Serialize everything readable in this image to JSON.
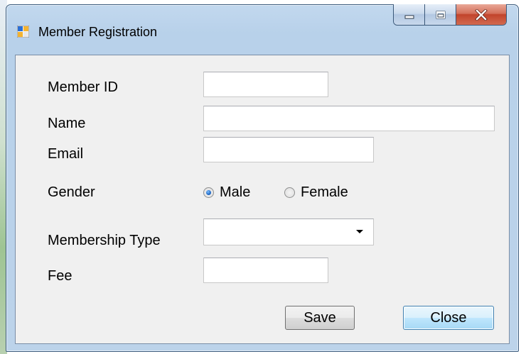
{
  "window": {
    "title": "Member Registration",
    "controls": {
      "minimize": "minimize",
      "maximize": "maximize",
      "close": "close"
    }
  },
  "form": {
    "member_id": {
      "label": "Member ID",
      "value": ""
    },
    "name": {
      "label": "Name",
      "value": ""
    },
    "email": {
      "label": "Email",
      "value": ""
    },
    "gender": {
      "label": "Gender",
      "options": [
        {
          "label": "Male",
          "checked": true
        },
        {
          "label": "Female",
          "checked": false
        }
      ]
    },
    "membership_type": {
      "label": "Membership Type",
      "selected": ""
    },
    "fee": {
      "label": "Fee",
      "value": ""
    }
  },
  "buttons": {
    "save": "Save",
    "close": "Close"
  },
  "colors": {
    "title_bar": "#bcd3ea",
    "close_button": "#c2442c",
    "client_background": "#f0f0f0",
    "focused_button_border": "#3c7fb1"
  }
}
